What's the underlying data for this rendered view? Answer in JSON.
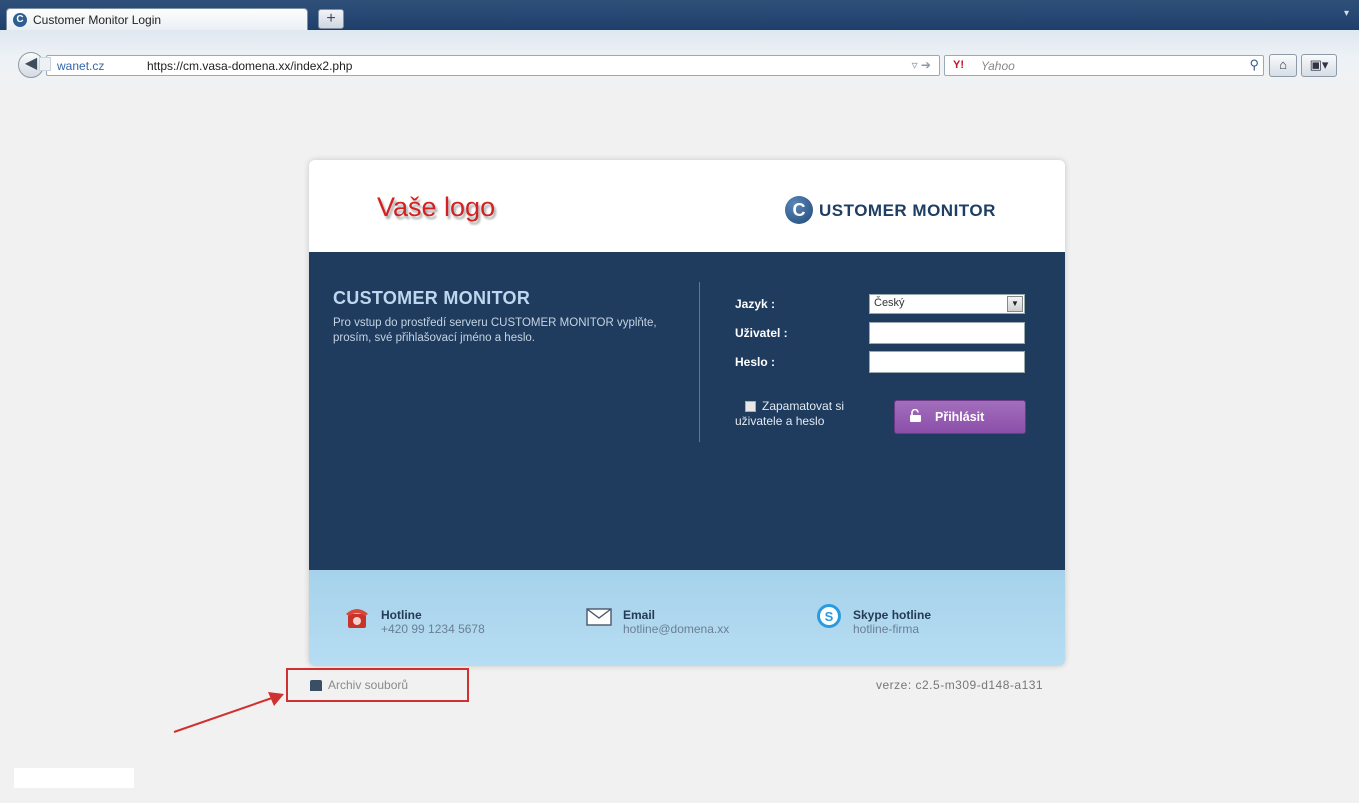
{
  "browser": {
    "tab_title": "Customer Monitor Login",
    "new_tab_label": "+",
    "url_site": "wanet.cz",
    "url": "https://cm.vasa-domena.xx/index2.php",
    "search_engine_logo": "Y!",
    "search_placeholder": "Yahoo"
  },
  "header": {
    "logo_text": "Vaše logo",
    "brand_initial": "C",
    "brand_text": "USTOMER MONITOR"
  },
  "intro": {
    "title": "CUSTOMER MONITOR",
    "description": "Pro vstup do prostředí serveru CUSTOMER MONITOR vyplňte, prosím, své přihlašovací jméno a heslo."
  },
  "form": {
    "language_label": "Jazyk :",
    "language_value": "Český",
    "user_label": "Uživatel :",
    "user_value": "",
    "password_label": "Heslo :",
    "password_value": "",
    "remember_label": "Zapamatovat si uživatele a heslo",
    "login_button": "Přihlásit"
  },
  "footer": {
    "hotline_title": "Hotline",
    "hotline_value": "+420 99 1234 5678",
    "email_title": "Email",
    "email_value": "hotline@domena.xx",
    "skype_title": "Skype hotline",
    "skype_value": "hotline-firma"
  },
  "below": {
    "archive_link": "Archiv souborů",
    "version": "verze: c2.5-m309-d148-a131"
  },
  "colors": {
    "card_body": "#1f3b5e",
    "login_button": "#9560b3",
    "footer": "#a6d2eb",
    "logo_red": "#d42020",
    "annotation_red": "#d03030"
  }
}
